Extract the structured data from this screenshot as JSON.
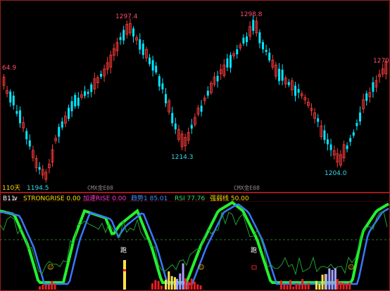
{
  "main_panel": {
    "period_label": "110天",
    "watermark_left": "CMX金E08",
    "watermark_right": "CMX金E08",
    "price_labels": {
      "left_cut": "64.9",
      "peak1": "1297.4",
      "peak2": "1298.8",
      "right_cut": "1270.",
      "trough_mid": "1214.3",
      "trough_left": "1194.5",
      "trough_right": "1204.0"
    },
    "colors": {
      "up_candle": "#ff3b3b",
      "down_candle": "#00e5ff",
      "label_high": "#ff4d6d",
      "label_low": "#32d9f0",
      "border": "#9e1b1b"
    }
  },
  "indicator_panel": {
    "title_label": "B11",
    "title_arrow": "∨",
    "strongrise_label": "STRONGRISE 0.00",
    "rise_label": "加速RISE 0.00",
    "trend_label": "趋势1 85.01",
    "rsi_label": "RSI 77.76",
    "weak_label": "强弱线 50.00",
    "run_label_1": "跑",
    "run_label_2": "跑",
    "smiley_icon": "☺",
    "colors": {
      "title": "#ffffff",
      "strongrise": "#f2e600",
      "rise": "#ff3bd6",
      "trend": "#3f8cff",
      "rsi": "#27e06d",
      "weak": "#ffdd00",
      "red_bar": "#e8201f",
      "yellow_bar": "#ffe14a",
      "lavender_bar": "#a6a2ff",
      "green_block": "#23f02f",
      "blue_line": "#3a77ff",
      "thin_line": "#1f9f2f"
    }
  }
}
